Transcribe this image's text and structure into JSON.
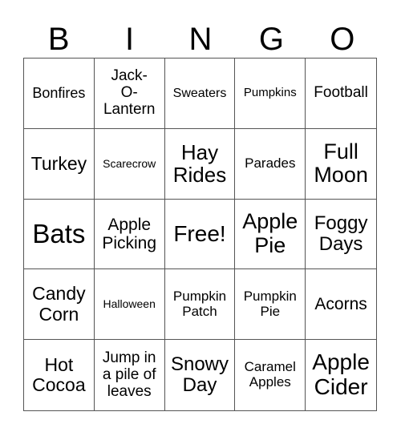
{
  "header": [
    "B",
    "I",
    "N",
    "G",
    "O"
  ],
  "cells": [
    "Bonfires",
    "Jack-O-Lantern",
    "Sweaters",
    "Pumpkins",
    "Football",
    "Turkey",
    "Scarecrow",
    "Hay Rides",
    "Parades",
    "Full Moon",
    "Bats",
    "Apple Picking",
    "Free!",
    "Apple Pie",
    "Foggy Days",
    "Candy Corn",
    "Halloween",
    "Pumpkin Patch",
    "Pumpkin Pie",
    "Acorns",
    "Hot Cocoa",
    "Jump in a pile of leaves",
    "Snowy Day",
    "Caramel Apples",
    "Apple Cider"
  ]
}
